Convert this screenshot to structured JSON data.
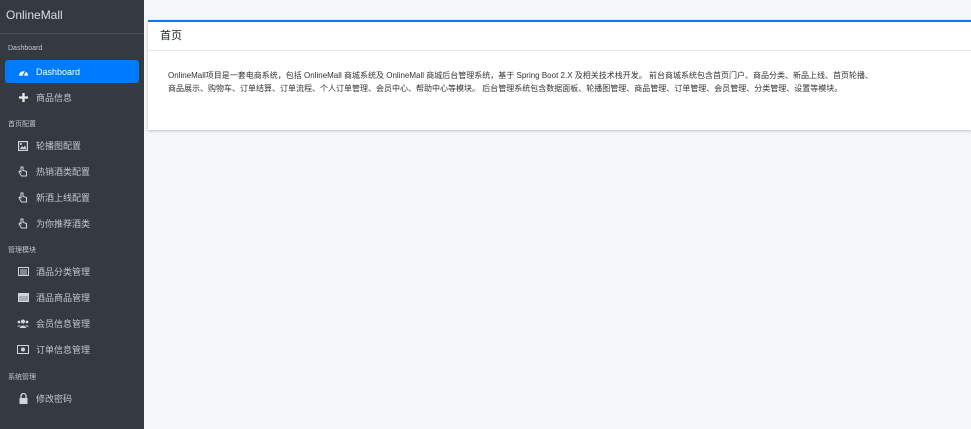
{
  "brand": "OnlineMall",
  "sidebar": {
    "sections": [
      {
        "label": "Dashboard",
        "items": [
          {
            "label": "Dashboard",
            "icon": "dashboard-icon",
            "active": true
          },
          {
            "label": "商品信息",
            "icon": "plus-icon",
            "active": false
          }
        ]
      },
      {
        "label": "首页配置",
        "items": [
          {
            "label": "轮播图配置",
            "icon": "image-icon",
            "active": false
          },
          {
            "label": "热销酒类配置",
            "icon": "hand-pointer-icon",
            "active": false
          },
          {
            "label": "新酒上线配置",
            "icon": "hand-pointer-icon",
            "active": false
          },
          {
            "label": "为你推荐酒类",
            "icon": "hand-pointer-icon",
            "active": false
          }
        ]
      },
      {
        "label": "管理模块",
        "items": [
          {
            "label": "酒品分类管理",
            "icon": "list-icon",
            "active": false
          },
          {
            "label": "酒品商品管理",
            "icon": "box-icon",
            "active": false
          },
          {
            "label": "会员信息管理",
            "icon": "users-icon",
            "active": false
          },
          {
            "label": "订单信息管理",
            "icon": "money-icon",
            "active": false
          }
        ]
      },
      {
        "label": "系统管理",
        "items": [
          {
            "label": "修改密码",
            "icon": "lock-icon",
            "active": false
          }
        ]
      }
    ]
  },
  "main": {
    "card_title": "首页",
    "lines": [
      "OnlineMall项目是一套电商系统，包括 OnlineMall 商城系统及 OnlineMall 商城后台管理系统，基于 Spring Boot 2.X 及相关技术栈开发。 前台商城系统包含首页门户、商品分类、新品上线、首页轮播、",
      "商品展示、购物车、订单结算、订单流程、个人订单管理、会员中心、帮助中心等模块。 后台管理系统包含数据面板、轮播图管理、商品管理、订单管理、会员管理、分类管理、设置等模块。"
    ]
  },
  "colors": {
    "sidebar_bg": "#343a40",
    "accent": "#007bff",
    "content_bg": "#f4f6f9"
  }
}
